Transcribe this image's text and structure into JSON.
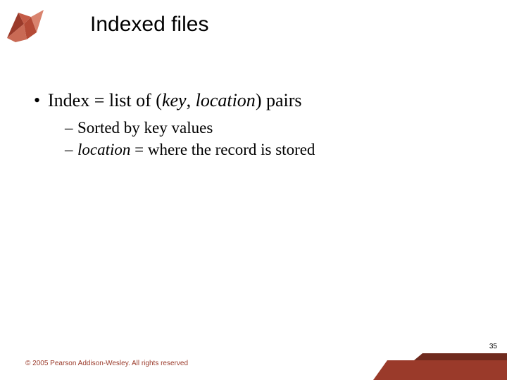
{
  "title": "Indexed files",
  "bullet": {
    "prefix": "Index = list of (",
    "key": "key",
    "mid": ", ",
    "loc": "location",
    "suffix": ") pairs"
  },
  "subs": [
    {
      "dash": "–",
      "text": "Sorted by key values"
    },
    {
      "dash": "–",
      "loc": "location",
      "text2": " = where the record is stored"
    }
  ],
  "footer": "© 2005 Pearson Addison-Wesley. All rights reserved",
  "page": "35"
}
